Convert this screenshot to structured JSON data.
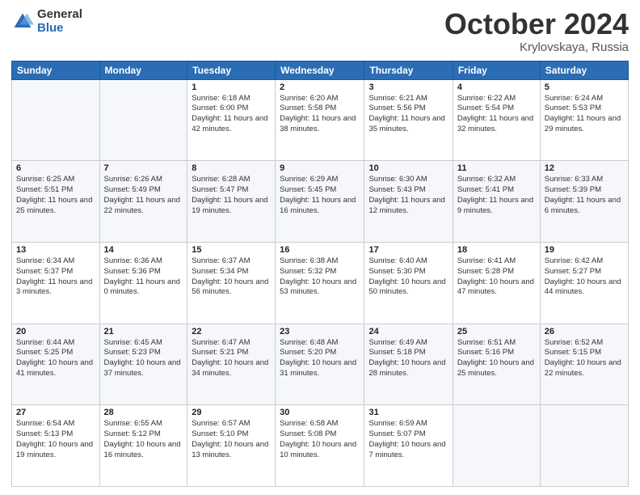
{
  "logo": {
    "general": "General",
    "blue": "Blue"
  },
  "header": {
    "month": "October 2024",
    "location": "Krylovskaya, Russia"
  },
  "weekdays": [
    "Sunday",
    "Monday",
    "Tuesday",
    "Wednesday",
    "Thursday",
    "Friday",
    "Saturday"
  ],
  "weeks": [
    [
      {
        "day": "",
        "sunrise": "",
        "sunset": "",
        "daylight": ""
      },
      {
        "day": "",
        "sunrise": "",
        "sunset": "",
        "daylight": ""
      },
      {
        "day": "1",
        "sunrise": "Sunrise: 6:18 AM",
        "sunset": "Sunset: 6:00 PM",
        "daylight": "Daylight: 11 hours and 42 minutes."
      },
      {
        "day": "2",
        "sunrise": "Sunrise: 6:20 AM",
        "sunset": "Sunset: 5:58 PM",
        "daylight": "Daylight: 11 hours and 38 minutes."
      },
      {
        "day": "3",
        "sunrise": "Sunrise: 6:21 AM",
        "sunset": "Sunset: 5:56 PM",
        "daylight": "Daylight: 11 hours and 35 minutes."
      },
      {
        "day": "4",
        "sunrise": "Sunrise: 6:22 AM",
        "sunset": "Sunset: 5:54 PM",
        "daylight": "Daylight: 11 hours and 32 minutes."
      },
      {
        "day": "5",
        "sunrise": "Sunrise: 6:24 AM",
        "sunset": "Sunset: 5:53 PM",
        "daylight": "Daylight: 11 hours and 29 minutes."
      }
    ],
    [
      {
        "day": "6",
        "sunrise": "Sunrise: 6:25 AM",
        "sunset": "Sunset: 5:51 PM",
        "daylight": "Daylight: 11 hours and 25 minutes."
      },
      {
        "day": "7",
        "sunrise": "Sunrise: 6:26 AM",
        "sunset": "Sunset: 5:49 PM",
        "daylight": "Daylight: 11 hours and 22 minutes."
      },
      {
        "day": "8",
        "sunrise": "Sunrise: 6:28 AM",
        "sunset": "Sunset: 5:47 PM",
        "daylight": "Daylight: 11 hours and 19 minutes."
      },
      {
        "day": "9",
        "sunrise": "Sunrise: 6:29 AM",
        "sunset": "Sunset: 5:45 PM",
        "daylight": "Daylight: 11 hours and 16 minutes."
      },
      {
        "day": "10",
        "sunrise": "Sunrise: 6:30 AM",
        "sunset": "Sunset: 5:43 PM",
        "daylight": "Daylight: 11 hours and 12 minutes."
      },
      {
        "day": "11",
        "sunrise": "Sunrise: 6:32 AM",
        "sunset": "Sunset: 5:41 PM",
        "daylight": "Daylight: 11 hours and 9 minutes."
      },
      {
        "day": "12",
        "sunrise": "Sunrise: 6:33 AM",
        "sunset": "Sunset: 5:39 PM",
        "daylight": "Daylight: 11 hours and 6 minutes."
      }
    ],
    [
      {
        "day": "13",
        "sunrise": "Sunrise: 6:34 AM",
        "sunset": "Sunset: 5:37 PM",
        "daylight": "Daylight: 11 hours and 3 minutes."
      },
      {
        "day": "14",
        "sunrise": "Sunrise: 6:36 AM",
        "sunset": "Sunset: 5:36 PM",
        "daylight": "Daylight: 11 hours and 0 minutes."
      },
      {
        "day": "15",
        "sunrise": "Sunrise: 6:37 AM",
        "sunset": "Sunset: 5:34 PM",
        "daylight": "Daylight: 10 hours and 56 minutes."
      },
      {
        "day": "16",
        "sunrise": "Sunrise: 6:38 AM",
        "sunset": "Sunset: 5:32 PM",
        "daylight": "Daylight: 10 hours and 53 minutes."
      },
      {
        "day": "17",
        "sunrise": "Sunrise: 6:40 AM",
        "sunset": "Sunset: 5:30 PM",
        "daylight": "Daylight: 10 hours and 50 minutes."
      },
      {
        "day": "18",
        "sunrise": "Sunrise: 6:41 AM",
        "sunset": "Sunset: 5:28 PM",
        "daylight": "Daylight: 10 hours and 47 minutes."
      },
      {
        "day": "19",
        "sunrise": "Sunrise: 6:42 AM",
        "sunset": "Sunset: 5:27 PM",
        "daylight": "Daylight: 10 hours and 44 minutes."
      }
    ],
    [
      {
        "day": "20",
        "sunrise": "Sunrise: 6:44 AM",
        "sunset": "Sunset: 5:25 PM",
        "daylight": "Daylight: 10 hours and 41 minutes."
      },
      {
        "day": "21",
        "sunrise": "Sunrise: 6:45 AM",
        "sunset": "Sunset: 5:23 PM",
        "daylight": "Daylight: 10 hours and 37 minutes."
      },
      {
        "day": "22",
        "sunrise": "Sunrise: 6:47 AM",
        "sunset": "Sunset: 5:21 PM",
        "daylight": "Daylight: 10 hours and 34 minutes."
      },
      {
        "day": "23",
        "sunrise": "Sunrise: 6:48 AM",
        "sunset": "Sunset: 5:20 PM",
        "daylight": "Daylight: 10 hours and 31 minutes."
      },
      {
        "day": "24",
        "sunrise": "Sunrise: 6:49 AM",
        "sunset": "Sunset: 5:18 PM",
        "daylight": "Daylight: 10 hours and 28 minutes."
      },
      {
        "day": "25",
        "sunrise": "Sunrise: 6:51 AM",
        "sunset": "Sunset: 5:16 PM",
        "daylight": "Daylight: 10 hours and 25 minutes."
      },
      {
        "day": "26",
        "sunrise": "Sunrise: 6:52 AM",
        "sunset": "Sunset: 5:15 PM",
        "daylight": "Daylight: 10 hours and 22 minutes."
      }
    ],
    [
      {
        "day": "27",
        "sunrise": "Sunrise: 6:54 AM",
        "sunset": "Sunset: 5:13 PM",
        "daylight": "Daylight: 10 hours and 19 minutes."
      },
      {
        "day": "28",
        "sunrise": "Sunrise: 6:55 AM",
        "sunset": "Sunset: 5:12 PM",
        "daylight": "Daylight: 10 hours and 16 minutes."
      },
      {
        "day": "29",
        "sunrise": "Sunrise: 6:57 AM",
        "sunset": "Sunset: 5:10 PM",
        "daylight": "Daylight: 10 hours and 13 minutes."
      },
      {
        "day": "30",
        "sunrise": "Sunrise: 6:58 AM",
        "sunset": "Sunset: 5:08 PM",
        "daylight": "Daylight: 10 hours and 10 minutes."
      },
      {
        "day": "31",
        "sunrise": "Sunrise: 6:59 AM",
        "sunset": "Sunset: 5:07 PM",
        "daylight": "Daylight: 10 hours and 7 minutes."
      },
      {
        "day": "",
        "sunrise": "",
        "sunset": "",
        "daylight": ""
      },
      {
        "day": "",
        "sunrise": "",
        "sunset": "",
        "daylight": ""
      }
    ]
  ]
}
